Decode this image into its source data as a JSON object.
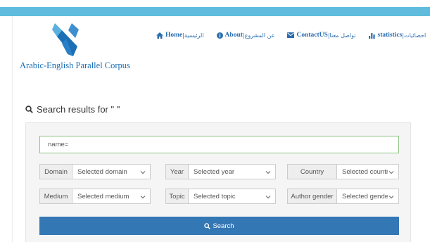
{
  "logo": {
    "text": "Arabic-English Parallel Corpus"
  },
  "nav": {
    "home": {
      "en": "Home",
      "ar": "|الرئيسية"
    },
    "about": {
      "en": "About",
      "ar": "|عن المشروع"
    },
    "contact": {
      "en": "ContactUS",
      "ar": "|تواصل معنا"
    },
    "statistics": {
      "en": "statistics",
      "ar": "|احصائيات"
    }
  },
  "results": {
    "title": "Search results for \" \""
  },
  "form": {
    "name_value": "name=",
    "domain": {
      "label": "Domain",
      "value": "Selected domain"
    },
    "year": {
      "label": "Year",
      "value": "Selected year"
    },
    "country": {
      "label": "Country",
      "value": "Selected country"
    },
    "medium": {
      "label": "Medium",
      "value": "Selected medium"
    },
    "topic": {
      "label": "Topic",
      "value": "Selected topic"
    },
    "author_gender": {
      "label": "Author gender",
      "value": "Selected gender"
    },
    "search_label": "Search"
  },
  "colors": {
    "top_bar": "#5fbcdc",
    "link": "#2a6db0",
    "search_button": "#3477b5",
    "input_focus_border": "#8cc481"
  },
  "icons": [
    "logo-mark-icon",
    "home-icon",
    "info-icon",
    "envelope-icon",
    "bar-chart-icon",
    "search-icon",
    "chevron-down-icon"
  ]
}
